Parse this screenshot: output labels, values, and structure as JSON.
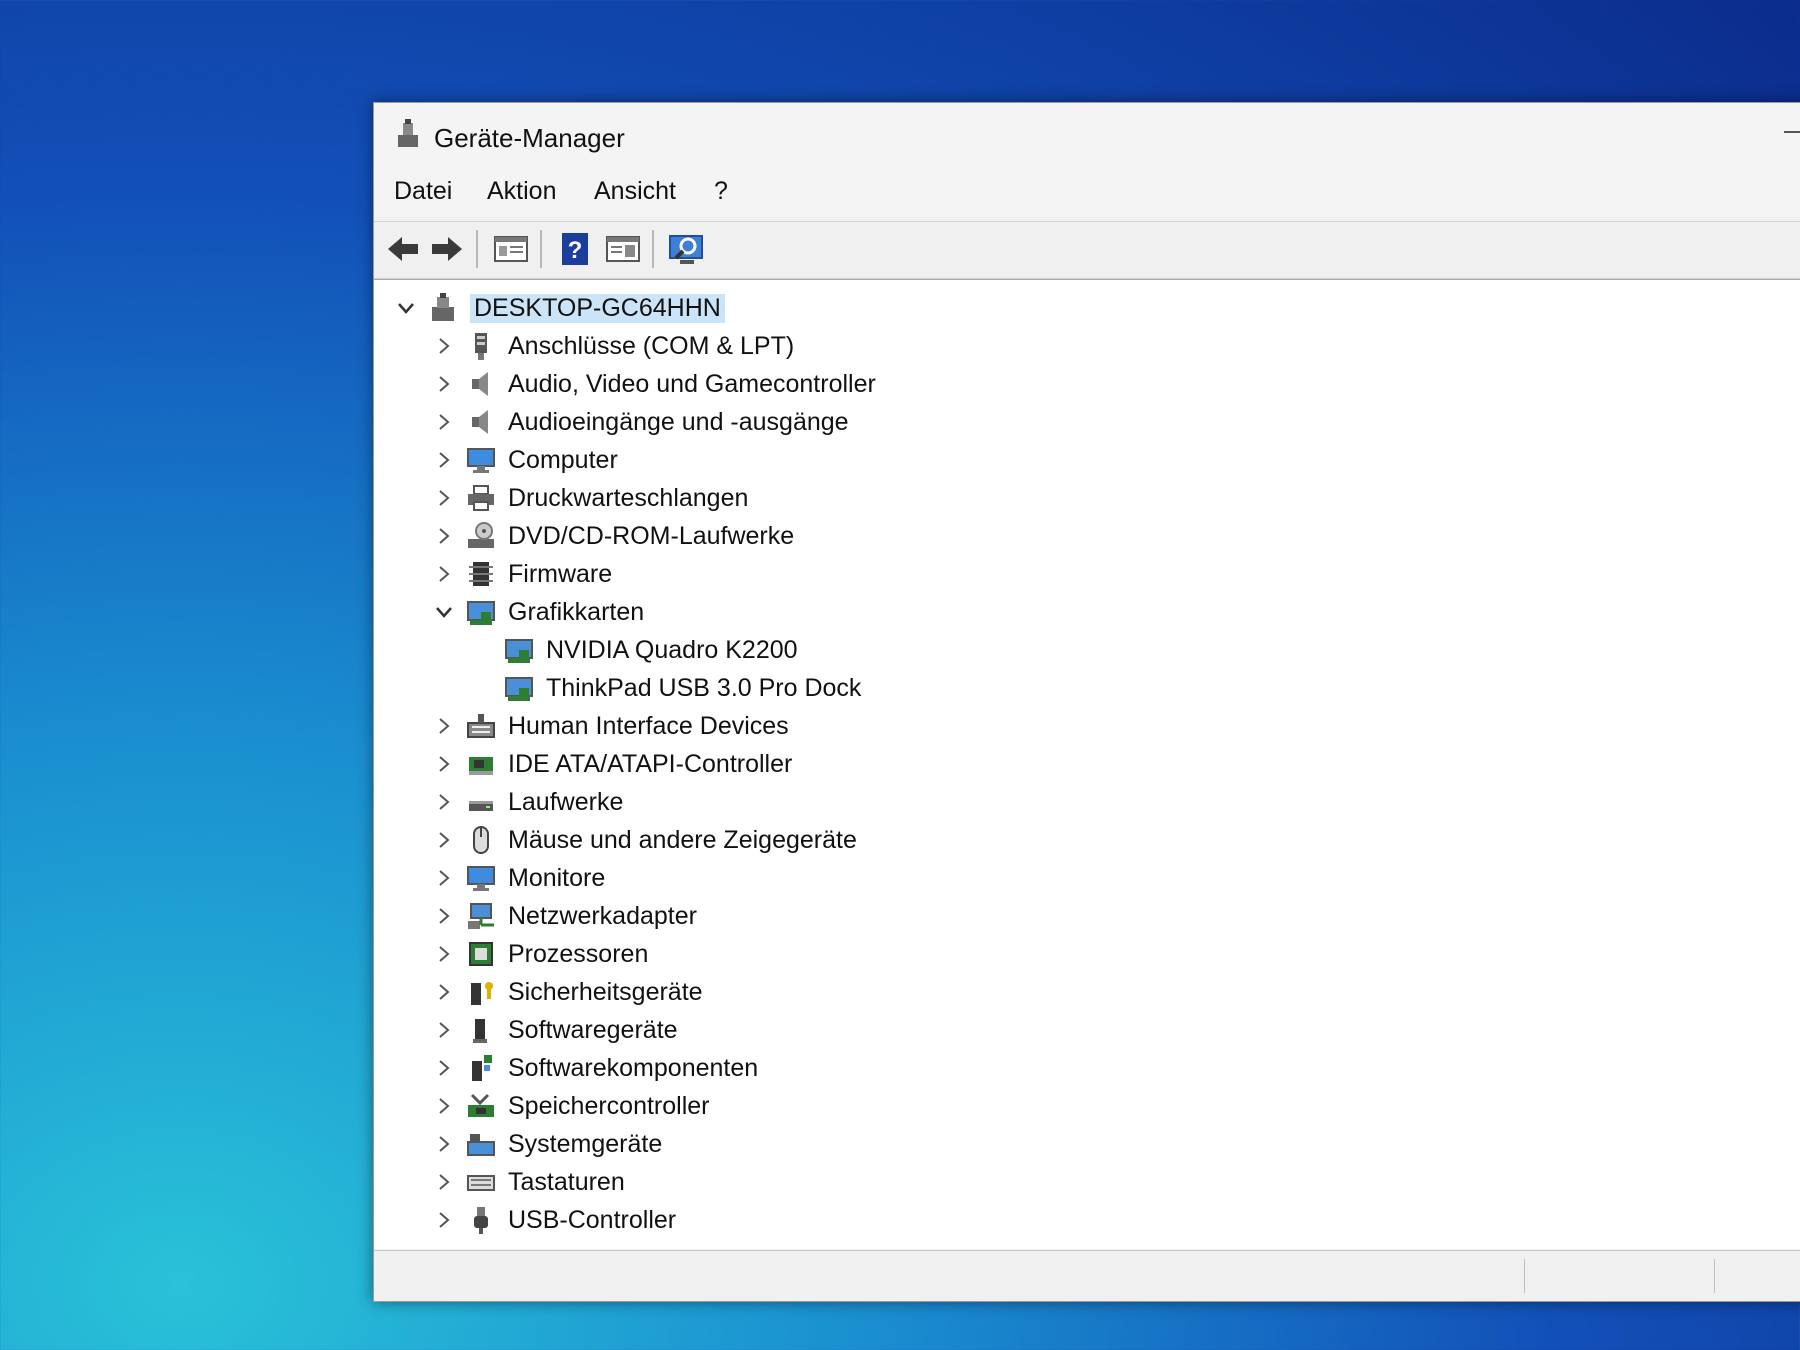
{
  "window": {
    "title": "Geräte-Manager"
  },
  "menu": [
    "Datei",
    "Aktion",
    "Ansicht",
    "?"
  ],
  "toolbar": {
    "buttons": [
      {
        "name": "back-icon"
      },
      {
        "name": "forward-icon"
      },
      {
        "name": "properties-icon"
      },
      {
        "name": "help-icon"
      },
      {
        "name": "view-icon"
      },
      {
        "name": "scan-hardware-icon"
      }
    ]
  },
  "tree": {
    "root": {
      "label": "DESKTOP-GC64HHN",
      "icon": "computer-icon",
      "expanded": true
    },
    "items": [
      {
        "label": "Anschlüsse (COM & LPT)",
        "icon": "port-icon",
        "level": 1,
        "expanded": false
      },
      {
        "label": "Audio, Video und Gamecontroller",
        "icon": "speaker-icon",
        "level": 1,
        "expanded": false
      },
      {
        "label": "Audioeingänge und -ausgänge",
        "icon": "speaker-icon",
        "level": 1,
        "expanded": false
      },
      {
        "label": "Computer",
        "icon": "monitor-icon",
        "level": 1,
        "expanded": false
      },
      {
        "label": "Druckwarteschlangen",
        "icon": "printer-icon",
        "level": 1,
        "expanded": false
      },
      {
        "label": "DVD/CD-ROM-Laufwerke",
        "icon": "dvd-drive-icon",
        "level": 1,
        "expanded": false
      },
      {
        "label": "Firmware",
        "icon": "chip-icon",
        "level": 1,
        "expanded": false
      },
      {
        "label": "Grafikkarten",
        "icon": "display-adapter-icon",
        "level": 1,
        "expanded": true
      },
      {
        "label": "NVIDIA Quadro K2200",
        "icon": "display-adapter-icon",
        "level": 2
      },
      {
        "label": "ThinkPad USB 3.0 Pro Dock",
        "icon": "display-adapter-icon",
        "level": 2
      },
      {
        "label": "Human Interface Devices",
        "icon": "hid-icon",
        "level": 1,
        "expanded": false
      },
      {
        "label": "IDE ATA/ATAPI-Controller",
        "icon": "controller-card-icon",
        "level": 1,
        "expanded": false
      },
      {
        "label": "Laufwerke",
        "icon": "disk-drive-icon",
        "level": 1,
        "expanded": false
      },
      {
        "label": "Mäuse und andere Zeigegeräte",
        "icon": "mouse-icon",
        "level": 1,
        "expanded": false
      },
      {
        "label": "Monitore",
        "icon": "monitor-icon",
        "level": 1,
        "expanded": false
      },
      {
        "label": "Netzwerkadapter",
        "icon": "network-icon",
        "level": 1,
        "expanded": false
      },
      {
        "label": "Prozessoren",
        "icon": "processor-icon",
        "level": 1,
        "expanded": false
      },
      {
        "label": "Sicherheitsgeräte",
        "icon": "security-device-icon",
        "level": 1,
        "expanded": false
      },
      {
        "label": "Softwaregeräte",
        "icon": "software-device-icon",
        "level": 1,
        "expanded": false
      },
      {
        "label": "Softwarekomponenten",
        "icon": "software-component-icon",
        "level": 1,
        "expanded": false
      },
      {
        "label": "Speichercontroller",
        "icon": "storage-controller-icon",
        "level": 1,
        "expanded": false
      },
      {
        "label": "Systemgeräte",
        "icon": "system-device-icon",
        "level": 1,
        "expanded": false
      },
      {
        "label": "Tastaturen",
        "icon": "keyboard-icon",
        "level": 1,
        "expanded": false
      },
      {
        "label": "USB-Controller",
        "icon": "usb-icon",
        "level": 1,
        "expanded": false
      }
    ]
  }
}
